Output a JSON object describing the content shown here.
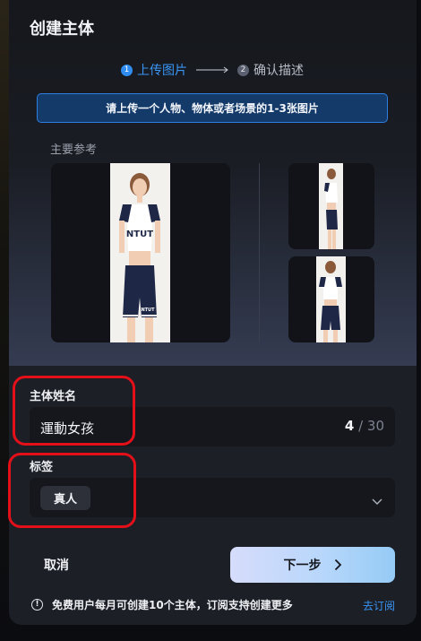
{
  "dialog": {
    "title": "创建主体"
  },
  "steps": [
    {
      "num": "1",
      "label": "上传图片",
      "state": "active"
    },
    {
      "num": "2",
      "label": "确认描述",
      "state": "inactive"
    }
  ],
  "hint": "请上传一个人物、物体或者场景的1-3张图片",
  "reference": {
    "label": "主要参考",
    "shirt_text": "NTUT",
    "shorts_text": "NTUT"
  },
  "name_field": {
    "label": "主体姓名",
    "value": "運動女孩",
    "count": "4",
    "separator": " / ",
    "max": "30"
  },
  "tag_field": {
    "label": "标签",
    "selected_tag": "真人"
  },
  "actions": {
    "cancel_label": "取消",
    "next_label": "下一步"
  },
  "footer": {
    "info_icon_glyph": "!",
    "note": "免费用户每月可创建10个主体，订阅支持创建更多",
    "subscribe_label": "去订阅"
  },
  "colors": {
    "accent": "#2f8cf0",
    "annotation": "#e3101a",
    "modal_bg": "#1c1f26"
  }
}
